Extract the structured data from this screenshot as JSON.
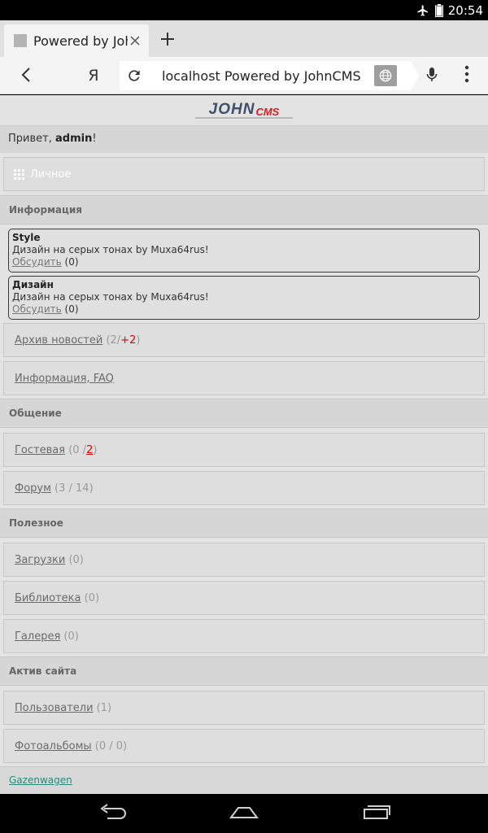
{
  "status_bar": {
    "time": "20:54"
  },
  "browser": {
    "tab_title": "Powered by JohnCMS",
    "yandex_label": "Я",
    "url_text": "localhost Powered by JohnCMS"
  },
  "page": {
    "logo": {
      "john": "JOHN",
      "cms": "CMS"
    },
    "greeting": {
      "prefix": "Привет, ",
      "user": "admin",
      "suffix": "!"
    },
    "personal_label": "Личное",
    "sections": {
      "info": "Информация",
      "communication": "Общение",
      "useful": "Полезное",
      "site_activity": "Актив сайта"
    },
    "news": [
      {
        "title": "Style",
        "text": "Дизайн на серых тонах by Muxa64rus!",
        "discuss_label": "Обсудить",
        "discuss_count": "(0)"
      },
      {
        "title": "Дизайн",
        "text": "Дизайн на серых тонах by Muxa64rus!",
        "discuss_label": "Обсудить",
        "discuss_count": "(0)"
      }
    ],
    "links": {
      "news_archive": {
        "label": "Архив новостей",
        "count_open": "(2/",
        "count_new": "+2",
        "count_close": ")"
      },
      "faq": {
        "label": "Информация, FAQ"
      },
      "guestbook": {
        "label": "Гостевая",
        "count_open": "(0 / ",
        "count_new": "2",
        "count_close": ")"
      },
      "forum": {
        "label": "Форум",
        "count": "(3 / 14)"
      },
      "downloads": {
        "label": "Загрузки",
        "count": "(0)"
      },
      "library": {
        "label": "Библиотека",
        "count": "(0)"
      },
      "gallery": {
        "label": "Галерея",
        "count": "(0)"
      },
      "users": {
        "label": "Пользователи",
        "count": "(1)"
      },
      "photo_albums": {
        "label": "Фотоальбомы",
        "count": "(0 / 0)"
      }
    },
    "footer_link": "Gazenwagen"
  },
  "colors": {
    "page_bg": "#e3e3e3",
    "accent_red": "#dd0000",
    "footer_link": "#2a8a7a"
  }
}
